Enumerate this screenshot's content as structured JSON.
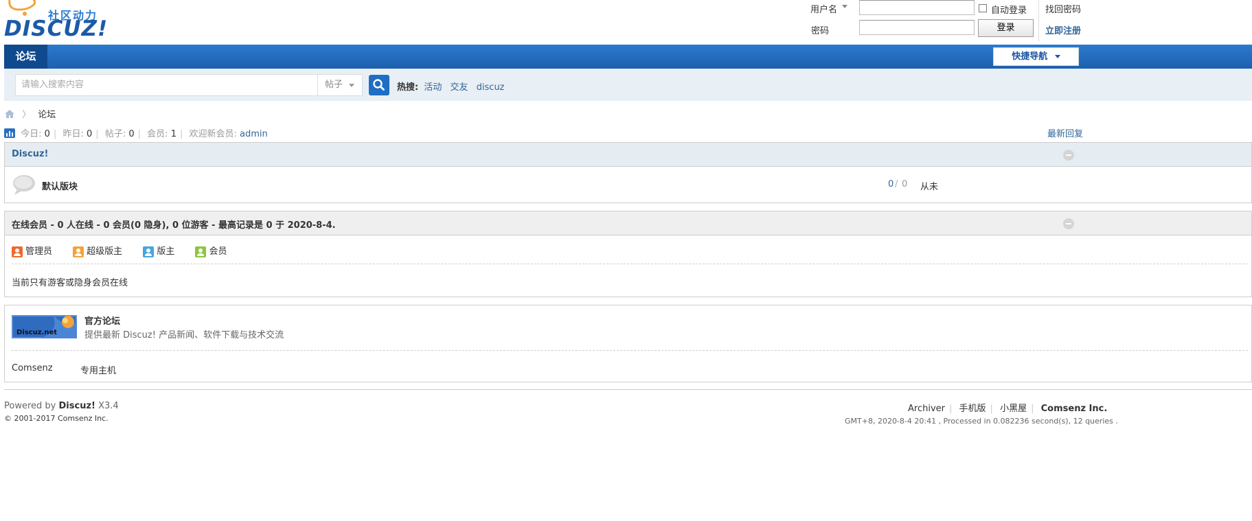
{
  "logo": {
    "slogan": "社区动力",
    "brand": "DISCUZ!"
  },
  "login": {
    "username_label": "用户名",
    "password_label": "密码",
    "auto_login_label": "自动登录",
    "login_button": "登录",
    "forgot_password": "找回密码",
    "register_link": "立即注册"
  },
  "nav": {
    "forum_tab": "论坛",
    "quick_nav": "快捷导航"
  },
  "search": {
    "placeholder": "请输入搜索内容",
    "type": "帖子",
    "hot_label": "热搜:",
    "hot_terms": [
      "活动",
      "交友",
      "discuz"
    ]
  },
  "breadcrumb": {
    "current": "论坛"
  },
  "stats": {
    "today_label": "今日:",
    "today": "0",
    "yesterday_label": "昨日:",
    "yesterday": "0",
    "posts_label": "帖子:",
    "posts": "0",
    "members_label": "会员:",
    "members": "1",
    "welcome_label": "欢迎新会员:",
    "new_member": "admin",
    "latest_link": "最新回复"
  },
  "category": {
    "title": "Discuz!",
    "forum": {
      "name": "默认版块",
      "threads": "0",
      "slash": "/",
      "posts": "0",
      "last_post": "从未"
    }
  },
  "online": {
    "title": "在线会员 - 0 人在线 - 0 会员(0 隐身), 0 位游客 - 最高记录是 0 于 2020-8-4.",
    "legend": [
      {
        "label": "管理员",
        "color": "#ef6a2c"
      },
      {
        "label": "超级版主",
        "color": "#f2a33a"
      },
      {
        "label": "版主",
        "color": "#46a6e0"
      },
      {
        "label": "会员",
        "color": "#8cc63f"
      }
    ],
    "message": "当前只有游客或隐身会员在线"
  },
  "links": {
    "official_name": "官方论坛",
    "official_desc": "提供最新 Discuz! 产品新闻、软件下载与技术交流",
    "banner_text": "Discuz.net",
    "text_links": [
      "Comsenz",
      "专用主机"
    ]
  },
  "footer": {
    "powered_prefix": "Powered by",
    "powered_brand": "Discuz!",
    "version": "X3.4",
    "copyright_prefix": "© 2001-2017",
    "copyright_company": "Comsenz Inc.",
    "links": [
      "Archiver",
      "手机版",
      "小黑屋"
    ],
    "company": "Comsenz Inc.",
    "processed": "GMT+8, 2020-8-4 20:41 , Processed in 0.082236 second(s), 12 queries ."
  }
}
